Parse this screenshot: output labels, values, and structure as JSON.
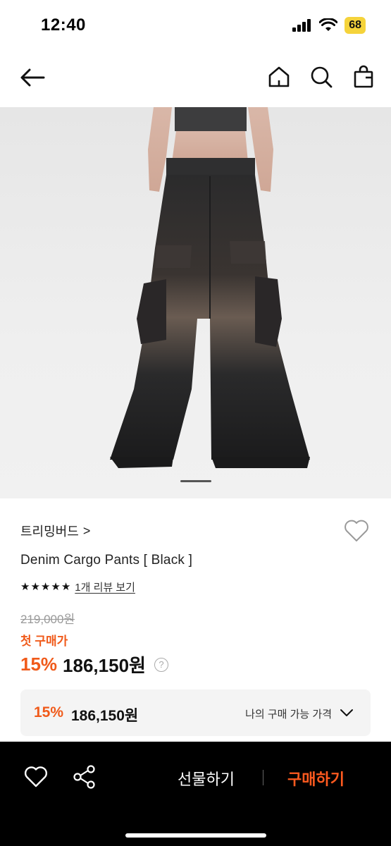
{
  "status_bar": {
    "time": "12:40",
    "battery": "68",
    "icons": [
      "cellular-signal-icon",
      "wifi-icon",
      "battery-icon"
    ]
  },
  "nav": {
    "icons": [
      "back-arrow-icon",
      "home-icon",
      "search-icon",
      "shopping-bag-icon"
    ]
  },
  "product": {
    "brand": "트리밍버드",
    "brand_chevron": ">",
    "title": "Denim Cargo Pants [ Black ]",
    "rating_stars": 5,
    "review_link": "1개 리뷰 보기",
    "original_price": "219,000원",
    "first_purchase_label": "첫 구매가",
    "discount": "15%",
    "price": "186,150원",
    "help_glyph": "?"
  },
  "price_box": {
    "discount": "15%",
    "price": "186,150원",
    "label": "나의 구매 가능 가격"
  },
  "bottom_bar": {
    "gift_label": "선물하기",
    "buy_label": "구매하기",
    "icons": [
      "heart-icon",
      "share-icon"
    ]
  },
  "colors": {
    "accent": "#f05a1a",
    "buy_accent": "#ff5a1f",
    "battery": "#f5d33b",
    "bottom_bar": "#000000"
  }
}
